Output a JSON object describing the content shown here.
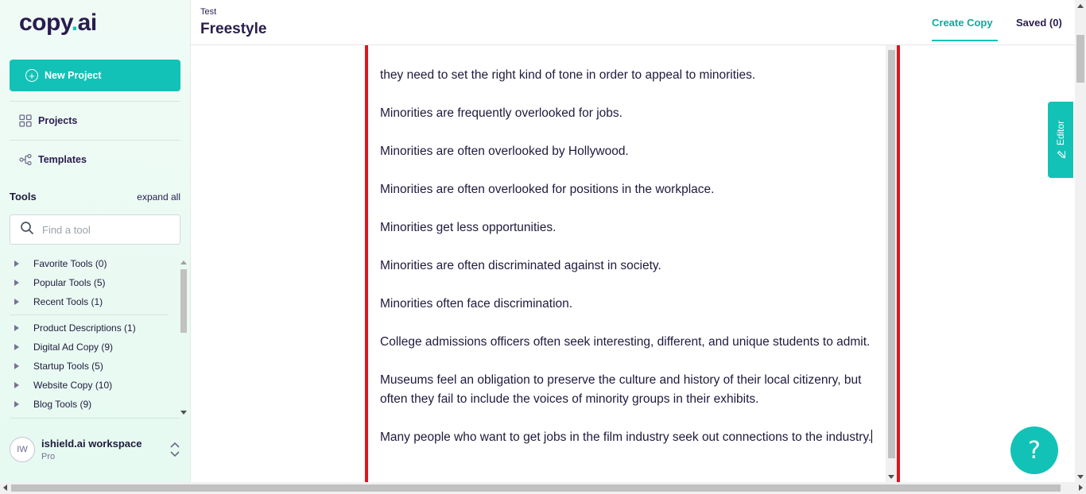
{
  "app": {
    "logo_text": "copy",
    "logo_dot": ".",
    "logo_suffix": "ai"
  },
  "sidebar": {
    "new_project_label": "New Project",
    "nav": [
      {
        "label": "Projects",
        "icon": "grid-icon"
      },
      {
        "label": "Templates",
        "icon": "templates-icon"
      }
    ],
    "tools_title": "Tools",
    "expand_all_label": "expand all",
    "search_placeholder": "Find a tool",
    "tool_groups": [
      {
        "label": "Favorite Tools (0)"
      },
      {
        "label": "Popular Tools (5)"
      },
      {
        "label": "Recent Tools (1)"
      },
      {
        "label": "Product Descriptions (1)"
      },
      {
        "label": "Digital Ad Copy (9)"
      },
      {
        "label": "Startup Tools (5)"
      },
      {
        "label": "Website Copy (10)"
      },
      {
        "label": "Blog Tools (9)"
      }
    ],
    "workspace": {
      "initials": "IW",
      "name": "ishield.ai workspace",
      "plan": "Pro"
    }
  },
  "header": {
    "breadcrumb": "Test",
    "title": "Freestyle",
    "tabs": [
      {
        "label": "Create Copy",
        "active": true
      },
      {
        "label": "Saved (0)",
        "active": false
      }
    ]
  },
  "editor": {
    "tab_label": "Editor",
    "paragraphs": [
      "they need to set the right kind of tone in order to appeal to minorities.",
      "Minorities are frequently overlooked for jobs.",
      "Minorities are often overlooked by Hollywood.",
      "Minorities are often overlooked for positions in the workplace.",
      "Minorities get less opportunities.",
      "Minorities are often discriminated against in society.",
      "Minorities often face discrimination.",
      "College admissions officers often seek interesting, different, and unique students to admit.",
      "Museums feel an obligation to preserve the culture and history of their local citizenry, but often they fail to include the voices of minority groups in their exhibits.",
      "Many people who want to get jobs in the film industry seek out connections to the industry."
    ]
  },
  "help": {
    "label": "?"
  },
  "colors": {
    "accent": "#13c2b7",
    "brand_dark": "#2a1c4e",
    "editor_border": "#e0141e"
  }
}
